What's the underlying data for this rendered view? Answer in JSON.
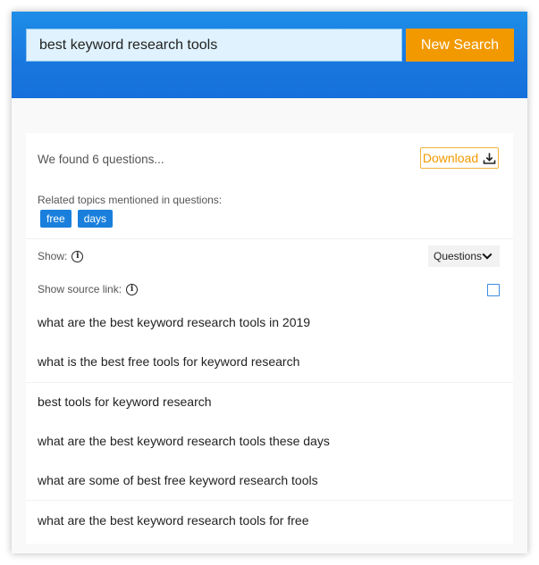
{
  "search": {
    "value": "best keyword research tools",
    "button_label": "New Search"
  },
  "results": {
    "found_text": "We found 6 questions...",
    "download_label": "Download",
    "related_label": "Related topics mentioned in questions:",
    "tags": [
      "free",
      "days"
    ],
    "show_label": "Show:",
    "show_select_value": "Questions",
    "source_link_label": "Show source link:",
    "source_link_checked": false,
    "questions": [
      "what are the best keyword research tools in 2019",
      "what is the best free tools for keyword research",
      "best tools for keyword research",
      "what are the best keyword research tools these days",
      "what are some of best free keyword research tools",
      "what are the best keyword research tools for free"
    ]
  },
  "colors": {
    "header_blue": "#1877df",
    "accent_orange": "#f29900",
    "tag_blue": "#1a7fdc"
  }
}
